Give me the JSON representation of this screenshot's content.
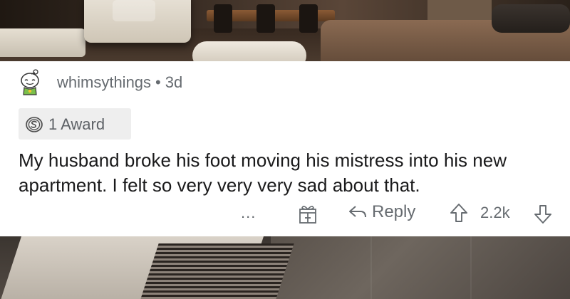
{
  "comment": {
    "username": "whimsythings",
    "separator": "•",
    "age": "3d",
    "award": {
      "icon": "silver-award-icon",
      "label": "1 Award"
    },
    "body": "My husband broke his foot moving his mistress into his new apartment.  I felt so very very very sad about that.",
    "actions": {
      "more_label": "...",
      "gift_icon": "gift-icon",
      "reply_label": "Reply",
      "score": "2.2k"
    }
  },
  "colors": {
    "meta_text": "#666b70",
    "body_text": "#1a1a1b",
    "award_chip_bg": "#eeeeee",
    "card_bg": "#ffffff"
  }
}
